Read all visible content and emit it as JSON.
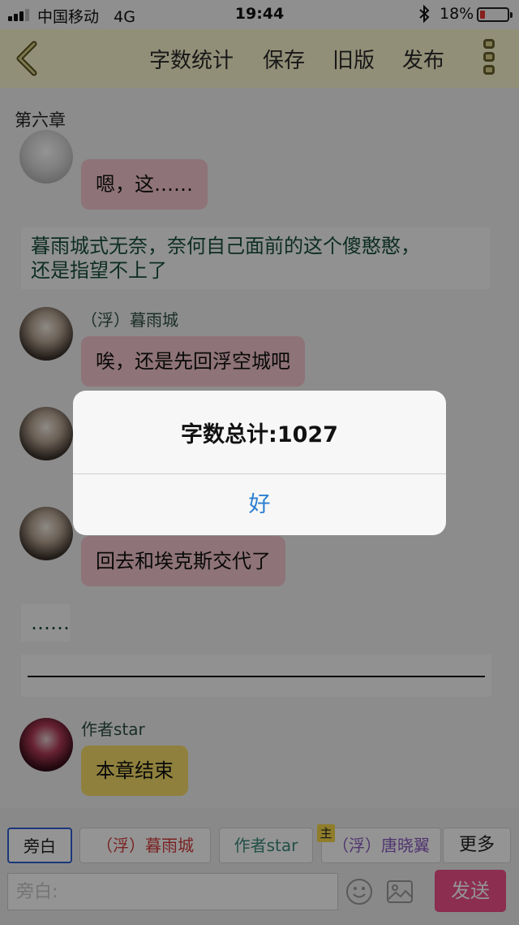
{
  "status": {
    "carrier": "中国移动",
    "network": "4G",
    "time": "19:44",
    "battery": "18%"
  },
  "navbar": {
    "items": [
      "字数统计",
      "保存",
      "旧版",
      "发布"
    ]
  },
  "chat": {
    "chapter": "第六章",
    "messages": [
      {
        "type": "bubble",
        "text": "嗯，这……"
      },
      {
        "type": "narration",
        "line1": "暮雨城式无奈，奈何自己面前的这个傻憨憨，",
        "line2": "还是指望不上了"
      },
      {
        "type": "bubble",
        "name": "（浮）暮雨城",
        "text": "唉，还是先回浮空城吧"
      },
      {
        "type": "bubble",
        "text": "回去和埃克斯交代了"
      },
      {
        "type": "narration",
        "text": "……"
      },
      {
        "type": "divider"
      },
      {
        "type": "bubble",
        "name": "作者star",
        "text": "本章结束"
      }
    ]
  },
  "bottom": {
    "roles": [
      "旁白",
      "（浮）暮雨城",
      "作者star",
      "（浮）唐晓翼"
    ],
    "host_badge": "主",
    "more": "更多",
    "input_placeholder": "旁白:",
    "send": "发送"
  },
  "dialog": {
    "title": "字数总计:1027",
    "ok": "好"
  },
  "colors": {
    "accent_blue": "#2a7fd0",
    "send_pink": "#f0508a",
    "bubble_pink": "#f4c7cf",
    "bubble_yellow": "#f7de6a",
    "navbar_bg": "#fbf6cf"
  }
}
